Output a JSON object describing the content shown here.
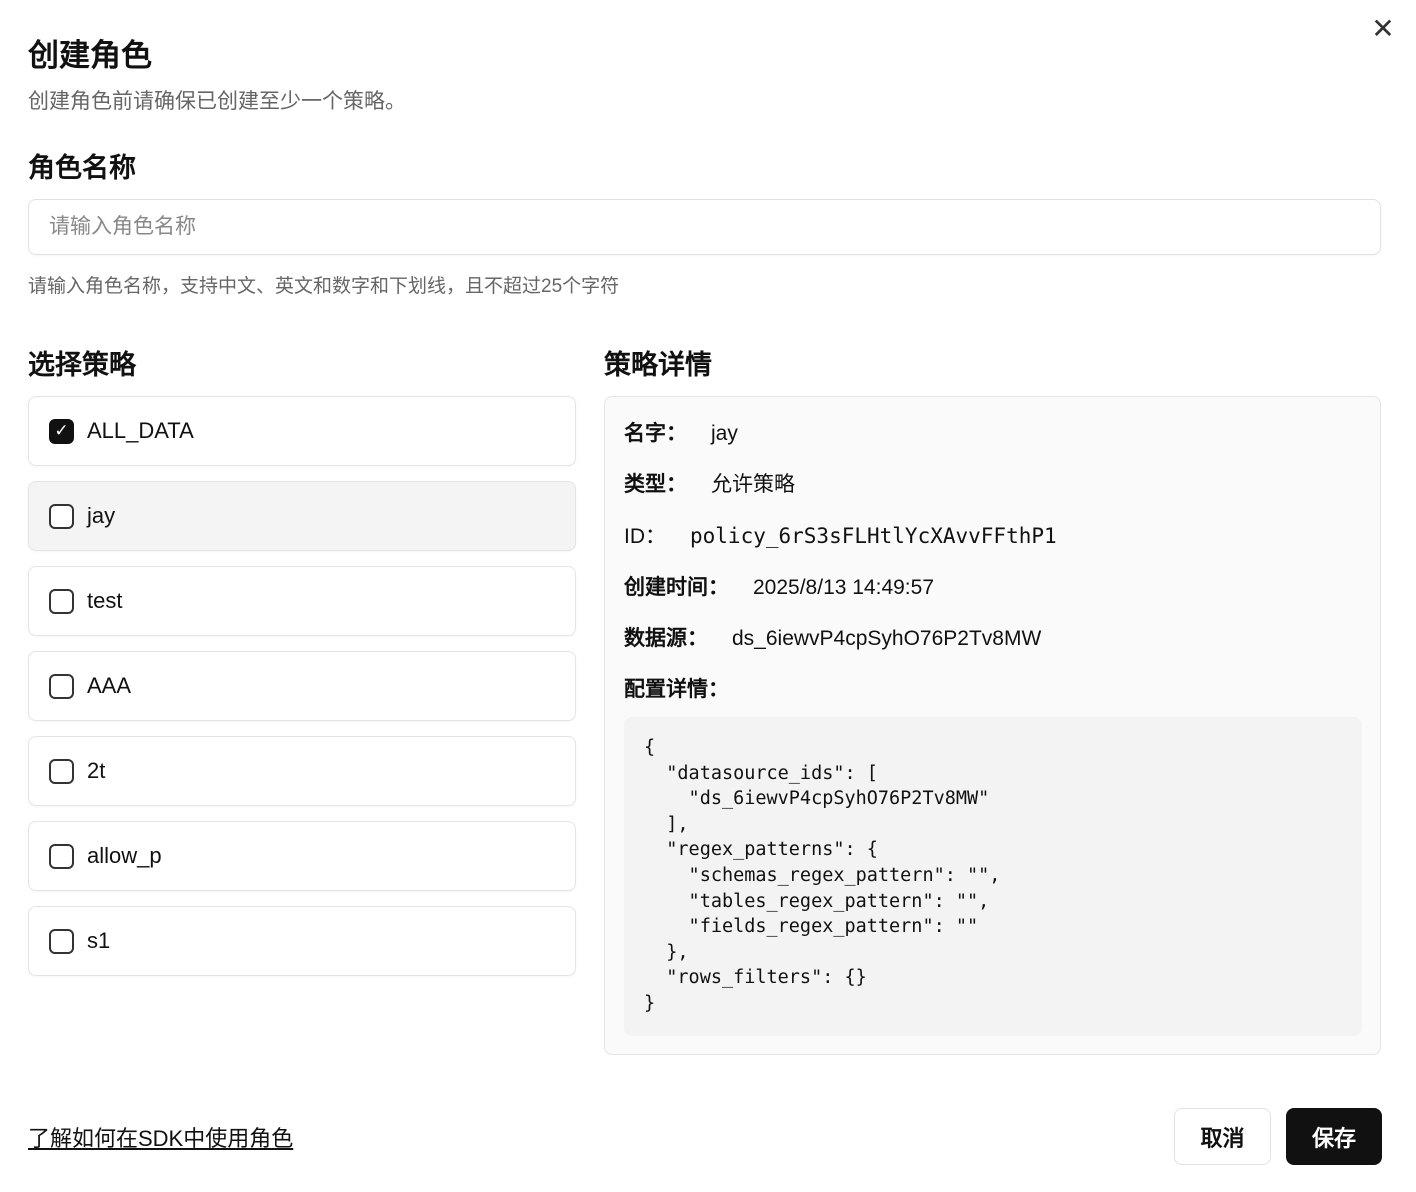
{
  "dialog": {
    "title": "创建角色",
    "subtitle": "创建角色前请确保已创建至少一个策略。",
    "close_icon": "close-icon"
  },
  "role_name": {
    "label": "角色名称",
    "value": "",
    "placeholder": "请输入角色名称",
    "hint": "请输入角色名称，支持中文、英文和数字和下划线，且不超过25个字符"
  },
  "policies": {
    "label": "选择策略",
    "items": [
      {
        "label": "ALL_DATA",
        "checked": true
      },
      {
        "label": "jay",
        "checked": false
      },
      {
        "label": "test",
        "checked": false
      },
      {
        "label": "AAA",
        "checked": false
      },
      {
        "label": "2t",
        "checked": false
      },
      {
        "label": "allow_p",
        "checked": false
      },
      {
        "label": "s1",
        "checked": false
      }
    ]
  },
  "details": {
    "label": "策略详情",
    "name_key": "名字：",
    "name": "jay",
    "type_key": "类型：",
    "type": "允许策略",
    "id_key": "ID：",
    "id": "policy_6rS3sFLHtlYcXAvvFFthP1",
    "created_key": "创建时间：",
    "created": "2025/8/13 14:49:57",
    "datasource_key": "数据源：",
    "datasource": "ds_6iewvP4cpSyhO76P2Tv8MW",
    "config_key": "配置详情：",
    "config": "{\n  \"datasource_ids\": [\n    \"ds_6iewvP4cpSyhO76P2Tv8MW\"\n  ],\n  \"regex_patterns\": {\n    \"schemas_regex_pattern\": \"\",\n    \"tables_regex_pattern\": \"\",\n    \"fields_regex_pattern\": \"\"\n  },\n  \"rows_filters\": {}\n}"
  },
  "footer": {
    "sdk_link": "了解如何在SDK中使用角色",
    "cancel": "取消",
    "save": "保存"
  }
}
